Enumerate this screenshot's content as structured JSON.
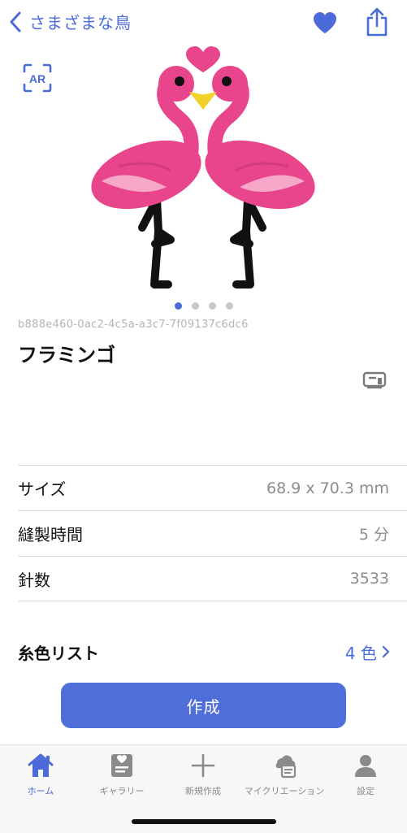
{
  "header": {
    "back_label": "さまざまな鳥",
    "icons": [
      "chevron-left-icon",
      "heart-icon",
      "share-icon"
    ]
  },
  "colors": {
    "accent": "#4a6bd8",
    "button": "#4f6ed8",
    "flamingo": "#e8458c",
    "heart": "#e8458c",
    "beak": "#f2d22a"
  },
  "item": {
    "uuid": "b888e460-0ac2-4c5a-a3c7-7f09137c6dc6",
    "name": "フラミンゴ",
    "ar_label": "AR"
  },
  "carousel": {
    "page_count": 4,
    "current_page": 1
  },
  "details": [
    {
      "label": "サイズ",
      "value": "68.9 x 70.3 mm"
    },
    {
      "label": "縫製時間",
      "value": "5 分"
    },
    {
      "label": "針数",
      "value": "3533"
    }
  ],
  "thread": {
    "label": "糸色リスト",
    "count": "4 色"
  },
  "create_button": "作成",
  "tabs": [
    {
      "label": "ホーム",
      "icon": "home-icon",
      "active": true
    },
    {
      "label": "ギャラリー",
      "icon": "gallery-icon",
      "active": false
    },
    {
      "label": "新規作成",
      "icon": "plus-icon",
      "active": false
    },
    {
      "label": "マイクリエーション",
      "icon": "my-creation-icon",
      "active": false
    },
    {
      "label": "設定",
      "icon": "person-icon",
      "active": false
    }
  ]
}
